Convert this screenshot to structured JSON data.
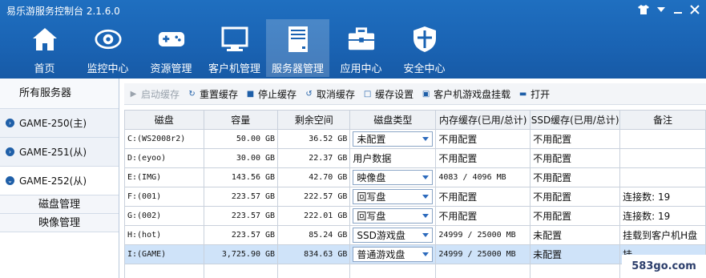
{
  "app": {
    "title": "易乐游服务控制台 2.1.6.0"
  },
  "window_controls": [
    {
      "name": "shirt-icon",
      "glyph": "👕"
    },
    {
      "name": "dropdown-icon",
      "glyph": "▼"
    },
    {
      "name": "minimize-icon",
      "glyph": "—"
    },
    {
      "name": "close-icon",
      "glyph": "✕"
    }
  ],
  "nav": [
    {
      "label": "首页",
      "icon": "home-icon"
    },
    {
      "label": "监控中心",
      "icon": "eye-icon"
    },
    {
      "label": "资源管理",
      "icon": "gamepad-icon"
    },
    {
      "label": "客户机管理",
      "icon": "monitor-icon"
    },
    {
      "label": "服务器管理",
      "icon": "server-icon",
      "active": true
    },
    {
      "label": "应用中心",
      "icon": "toolbox-icon"
    },
    {
      "label": "安全中心",
      "icon": "shield-icon"
    }
  ],
  "sidebar": {
    "header": "所有服务器",
    "servers": [
      {
        "label": "GAME-250(主)",
        "bullet": "›"
      },
      {
        "label": "GAME-251(从)",
        "bullet": "›"
      },
      {
        "label": "GAME-252(从)",
        "bullet": "⌄",
        "active": true
      }
    ],
    "subitems": [
      "磁盘管理",
      "映像管理"
    ]
  },
  "toolbar": [
    {
      "label": "启动缓存",
      "icon": "play-icon",
      "glyph": "▶",
      "disabled": true
    },
    {
      "label": "重置缓存",
      "icon": "reset-icon",
      "glyph": "↻"
    },
    {
      "label": "停止缓存",
      "icon": "stop-icon",
      "glyph": "■"
    },
    {
      "label": "取消缓存",
      "icon": "cancel-icon",
      "glyph": "↺"
    },
    {
      "label": "缓存设置",
      "icon": "settings-icon",
      "glyph": "□"
    },
    {
      "label": "客户机游戏盘挂载",
      "icon": "mount-icon",
      "glyph": "▣"
    },
    {
      "label": "打开",
      "icon": "folder-icon",
      "glyph": "▬"
    }
  ],
  "table": {
    "columns": [
      "磁盘",
      "容量",
      "剩余空间",
      "磁盘类型",
      "内存缓存(已用/总计)",
      "SSD缓存(已用/总计)",
      "备注"
    ],
    "rows": [
      {
        "disk": "C:(WS2008r2)",
        "capacity": "50.00 GB",
        "free": "36.52 GB",
        "type": "未配置",
        "type_dropdown": true,
        "mem": "不用配置",
        "ssd": "不用配置",
        "note": ""
      },
      {
        "disk": "D:(eyoo)",
        "capacity": "30.00 GB",
        "free": "22.37 GB",
        "type": "用户数据",
        "type_dropdown": false,
        "mem": "不用配置",
        "ssd": "不用配置",
        "note": ""
      },
      {
        "disk": "E:(IMG)",
        "capacity": "143.56 GB",
        "free": "42.70 GB",
        "type": "映像盘",
        "type_dropdown": true,
        "mem": "4083 / 4096 MB",
        "ssd": "不用配置",
        "note": ""
      },
      {
        "disk": "F:(001)",
        "capacity": "223.57 GB",
        "free": "222.57 GB",
        "type": "回写盘",
        "type_dropdown": true,
        "mem": "不用配置",
        "ssd": "不用配置",
        "note": "连接数: 19"
      },
      {
        "disk": "G:(002)",
        "capacity": "223.57 GB",
        "free": "222.01 GB",
        "type": "回写盘",
        "type_dropdown": true,
        "mem": "不用配置",
        "ssd": "不用配置",
        "note": "连接数: 19"
      },
      {
        "disk": "H:(hot)",
        "capacity": "223.57 GB",
        "free": "85.24 GB",
        "type": "SSD游戏盘",
        "type_dropdown": true,
        "mem": "24999 / 25000 MB",
        "ssd": "未配置",
        "note": "挂载到客户机H盘"
      },
      {
        "disk": "I:(GAME)",
        "capacity": "3,725.90 GB",
        "free": "834.63 GB",
        "type": "普通游戏盘",
        "type_dropdown": true,
        "mem": "24999 / 25000 MB",
        "ssd": "未配置",
        "note": "挂",
        "selected": true
      },
      {
        "disk": "",
        "capacity": "",
        "free": "",
        "type": "",
        "type_dropdown": false,
        "mem": "",
        "ssd": "",
        "note": ""
      }
    ]
  },
  "watermark": "583go.com"
}
